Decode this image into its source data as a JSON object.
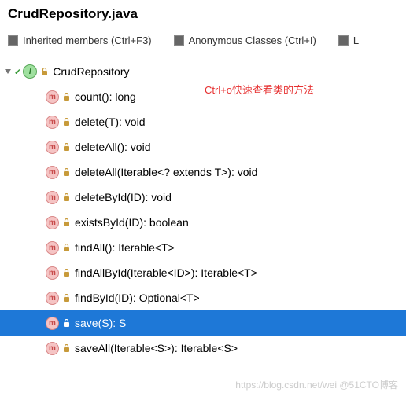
{
  "title": "CrudRepository.java",
  "filters": [
    {
      "label": "Inherited members (Ctrl+F3)"
    },
    {
      "label": "Anonymous Classes (Ctrl+I)"
    },
    {
      "label": "L"
    }
  ],
  "root": {
    "label": "CrudRepository",
    "icon_letter": "I"
  },
  "methods": [
    {
      "label": "count(): long",
      "selected": false
    },
    {
      "label": "delete(T): void",
      "selected": false
    },
    {
      "label": "deleteAll(): void",
      "selected": false
    },
    {
      "label": "deleteAll(Iterable<? extends T>): void",
      "selected": false
    },
    {
      "label": "deleteById(ID): void",
      "selected": false
    },
    {
      "label": "existsById(ID): boolean",
      "selected": false
    },
    {
      "label": "findAll(): Iterable<T>",
      "selected": false
    },
    {
      "label": "findAllById(Iterable<ID>): Iterable<T>",
      "selected": false
    },
    {
      "label": "findById(ID): Optional<T>",
      "selected": false
    },
    {
      "label": "save(S): S",
      "selected": true
    },
    {
      "label": "saveAll(Iterable<S>): Iterable<S>",
      "selected": false
    }
  ],
  "method_icon_letter": "m",
  "annotation_text": "Ctrl+o快速查看类的方法",
  "watermark": "https://blog.csdn.net/wei @51CTO博客"
}
